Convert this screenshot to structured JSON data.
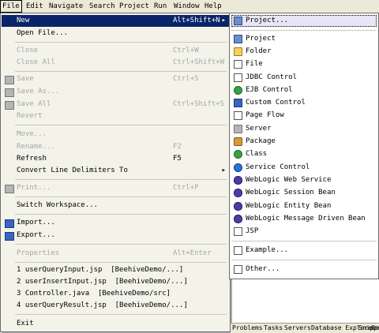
{
  "menubar": {
    "items": [
      {
        "label": "File"
      },
      {
        "label": "Edit"
      },
      {
        "label": "Navigate"
      },
      {
        "label": "Search"
      },
      {
        "label": "Project"
      },
      {
        "label": "Run"
      },
      {
        "label": "Window"
      },
      {
        "label": "Help"
      }
    ]
  },
  "file_menu": {
    "new": {
      "label": "New",
      "accel": "Alt+Shift+N"
    },
    "open_file": {
      "label": "Open File..."
    },
    "close": {
      "label": "Close",
      "accel": "Ctrl+W"
    },
    "close_all": {
      "label": "Close All",
      "accel": "Ctrl+Shift+W"
    },
    "save": {
      "label": "Save",
      "accel": "Ctrl+S"
    },
    "save_as": {
      "label": "Save As..."
    },
    "save_all": {
      "label": "Save All",
      "accel": "Ctrl+Shift+S"
    },
    "revert": {
      "label": "Revert"
    },
    "move": {
      "label": "Move..."
    },
    "rename": {
      "label": "Rename...",
      "accel": "F2"
    },
    "refresh": {
      "label": "Refresh",
      "accel": "F5"
    },
    "convert": {
      "label": "Convert Line Delimiters To"
    },
    "print": {
      "label": "Print...",
      "accel": "Ctrl+P"
    },
    "switch_workspace": {
      "label": "Switch Workspace..."
    },
    "import": {
      "label": "Import..."
    },
    "export": {
      "label": "Export..."
    },
    "properties": {
      "label": "Properties",
      "accel": "Alt+Enter"
    },
    "recent": [
      {
        "label": "1 userQueryInput.jsp  [BeehiveDemo/...]"
      },
      {
        "label": "2 userInsertInput.jsp  [BeehiveDemo/...]"
      },
      {
        "label": "3 Controller.java  [BeehiveDemo/src]"
      },
      {
        "label": "4 userQueryResult.jsp  [BeehiveDemo/...]"
      }
    ],
    "exit": {
      "label": "Exit"
    }
  },
  "new_submenu": {
    "items": [
      {
        "label": "Project...",
        "icon": "new-project-wizard-icon"
      },
      {
        "label": "Project",
        "icon": "project-icon"
      },
      {
        "label": "Folder",
        "icon": "folder-icon"
      },
      {
        "label": "File",
        "icon": "file-icon"
      },
      {
        "label": "JDBC Control",
        "icon": "jdbc-control-icon"
      },
      {
        "label": "EJB Control",
        "icon": "ejb-control-icon"
      },
      {
        "label": "Custom Control",
        "icon": "custom-control-icon"
      },
      {
        "label": "Page Flow",
        "icon": "page-flow-icon"
      },
      {
        "label": "Server",
        "icon": "server-icon"
      },
      {
        "label": "Package",
        "icon": "package-icon"
      },
      {
        "label": "Class",
        "icon": "class-icon"
      },
      {
        "label": "Service Control",
        "icon": "service-control-icon"
      },
      {
        "label": "WebLogic Web Service",
        "icon": "weblogic-web-service-icon"
      },
      {
        "label": "WebLogic Session Bean",
        "icon": "weblogic-session-bean-icon"
      },
      {
        "label": "WebLogic Entity Bean",
        "icon": "weblogic-entity-bean-icon"
      },
      {
        "label": "WebLogic Message Driven Bean",
        "icon": "weblogic-mdb-icon"
      },
      {
        "label": "JSP",
        "icon": "jsp-icon"
      },
      {
        "label": "Example...",
        "icon": "example-icon"
      },
      {
        "label": "Other...",
        "icon": "other-icon"
      }
    ]
  },
  "bottom_tabs": {
    "items": [
      {
        "label": "Problems"
      },
      {
        "label": "Tasks"
      },
      {
        "label": "Servers"
      },
      {
        "label": "Database Explorer"
      },
      {
        "label": "Snippets"
      },
      {
        "label": "Co"
      }
    ]
  }
}
